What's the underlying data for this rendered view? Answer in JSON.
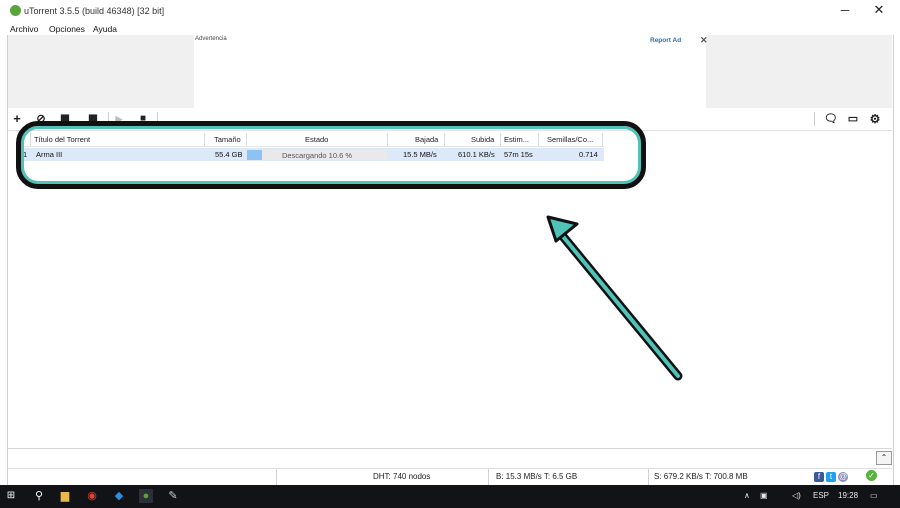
{
  "window": {
    "title": "uTorrent 3.5.5  (build 46348) [32 bit]",
    "minimize_glyph": "─",
    "close_glyph": "✕"
  },
  "menu": [
    "Archivo",
    "Opciones",
    "Ayuda"
  ],
  "ad": {
    "label": "Advertencia",
    "report": "Report Ad",
    "close": "✕"
  },
  "toolbar": {
    "left_icons": [
      "add-icon",
      "link-icon",
      "create-torrent-icon",
      "remove-icon",
      "start-icon",
      "stop-icon"
    ],
    "right_icons": [
      "chat-icon",
      "remote-icon",
      "settings-icon"
    ]
  },
  "table": {
    "columns": [
      "#",
      "Título del Torrent",
      "Tamaño",
      "Estado",
      "Bajada",
      "Subida",
      "Estim...",
      "Semillas/Co..."
    ],
    "rows": [
      {
        "index": "1",
        "name": "Arma III",
        "size": "55.4 GB",
        "status": "Descargando 10.6 %",
        "progress": 0.106,
        "down": "15.5 MB/s",
        "up": "610.1 KB/s",
        "eta": "57m 15s",
        "ratio": "0.714"
      }
    ]
  },
  "statusbar": {
    "dht": "DHT: 740 nodos",
    "download": "B: 15.3 MB/s T: 6.5 GB",
    "upload": "S: 679.2 KB/s T: 700.8 MB"
  },
  "taskbar": {
    "language": "ESP",
    "time": "19:28"
  },
  "annotation_color": "#4fc3b8"
}
